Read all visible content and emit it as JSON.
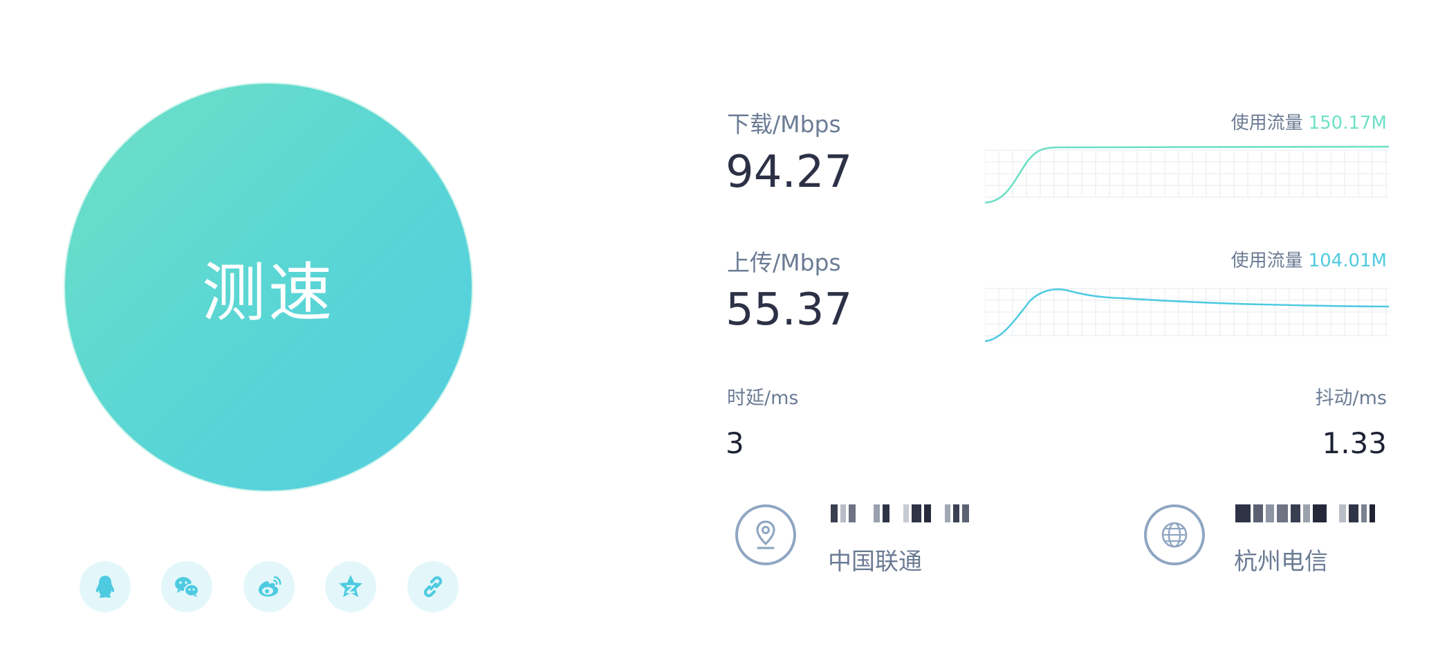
{
  "speed_button": {
    "label": "测速"
  },
  "share": {
    "items": [
      {
        "name": "qq-icon"
      },
      {
        "name": "wechat-icon"
      },
      {
        "name": "weibo-icon"
      },
      {
        "name": "qzone-icon"
      },
      {
        "name": "link-icon"
      }
    ]
  },
  "download": {
    "label": "下载/Mbps",
    "value": "94.27",
    "usage_label": "使用流量",
    "usage_value": "150.17M",
    "color": "#6de0c6"
  },
  "upload": {
    "label": "上传/Mbps",
    "value": "55.37",
    "usage_label": "使用流量",
    "usage_value": "104.01M",
    "color": "#4ecbe0"
  },
  "latency": {
    "label": "时延/ms",
    "value": "3"
  },
  "jitter": {
    "label": "抖动/ms",
    "value": "1.33"
  },
  "client": {
    "isp": "中国联通",
    "icon": "location-pin-icon"
  },
  "server": {
    "isp": "杭州电信",
    "icon": "globe-icon"
  },
  "colors": {
    "accent_green": "#6de0c6",
    "accent_blue": "#4ecbe0",
    "label_gray": "#6b7b94",
    "value_dark": "#2d3146",
    "share_bg": "#e3f7fb",
    "share_icon": "#4ecbe0"
  }
}
